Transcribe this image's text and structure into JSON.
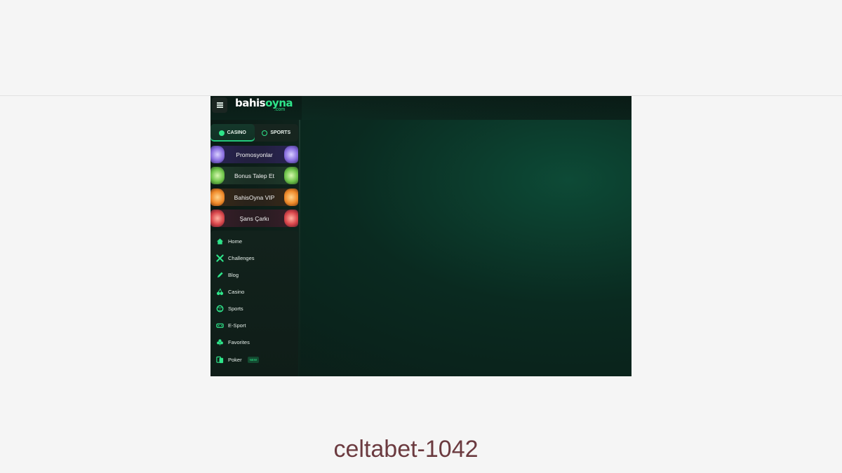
{
  "header": {
    "logo_main": "bahis",
    "logo_accent": "oyna",
    "logo_suffix": ".com"
  },
  "mode_switch": {
    "casino_label": "CASINO",
    "sports_label": "SPORTS",
    "active": "casino"
  },
  "promos": [
    {
      "label": "Promosyonlar"
    },
    {
      "label": "Bonus Talep Et"
    },
    {
      "label": "BahisOyna VIP"
    },
    {
      "label": "Şans Çarkı"
    }
  ],
  "nav": [
    {
      "label": "Home",
      "icon": "home-icon"
    },
    {
      "label": "Challenges",
      "icon": "challenges-icon"
    },
    {
      "label": "Blog",
      "icon": "pen-icon"
    },
    {
      "label": "Casino",
      "icon": "cherries-icon"
    },
    {
      "label": "Sports",
      "icon": "ball-icon"
    },
    {
      "label": "E-Sport",
      "icon": "gamepad-icon"
    },
    {
      "label": "Favorites",
      "icon": "club-icon"
    },
    {
      "label": "Poker",
      "icon": "cards-icon",
      "badge": "NEW"
    }
  ],
  "caption": "celtabet-1042",
  "colors": {
    "accent": "#2ee58a",
    "sidebar_bg": "#0e231c",
    "caption": "#6b3a3f"
  }
}
